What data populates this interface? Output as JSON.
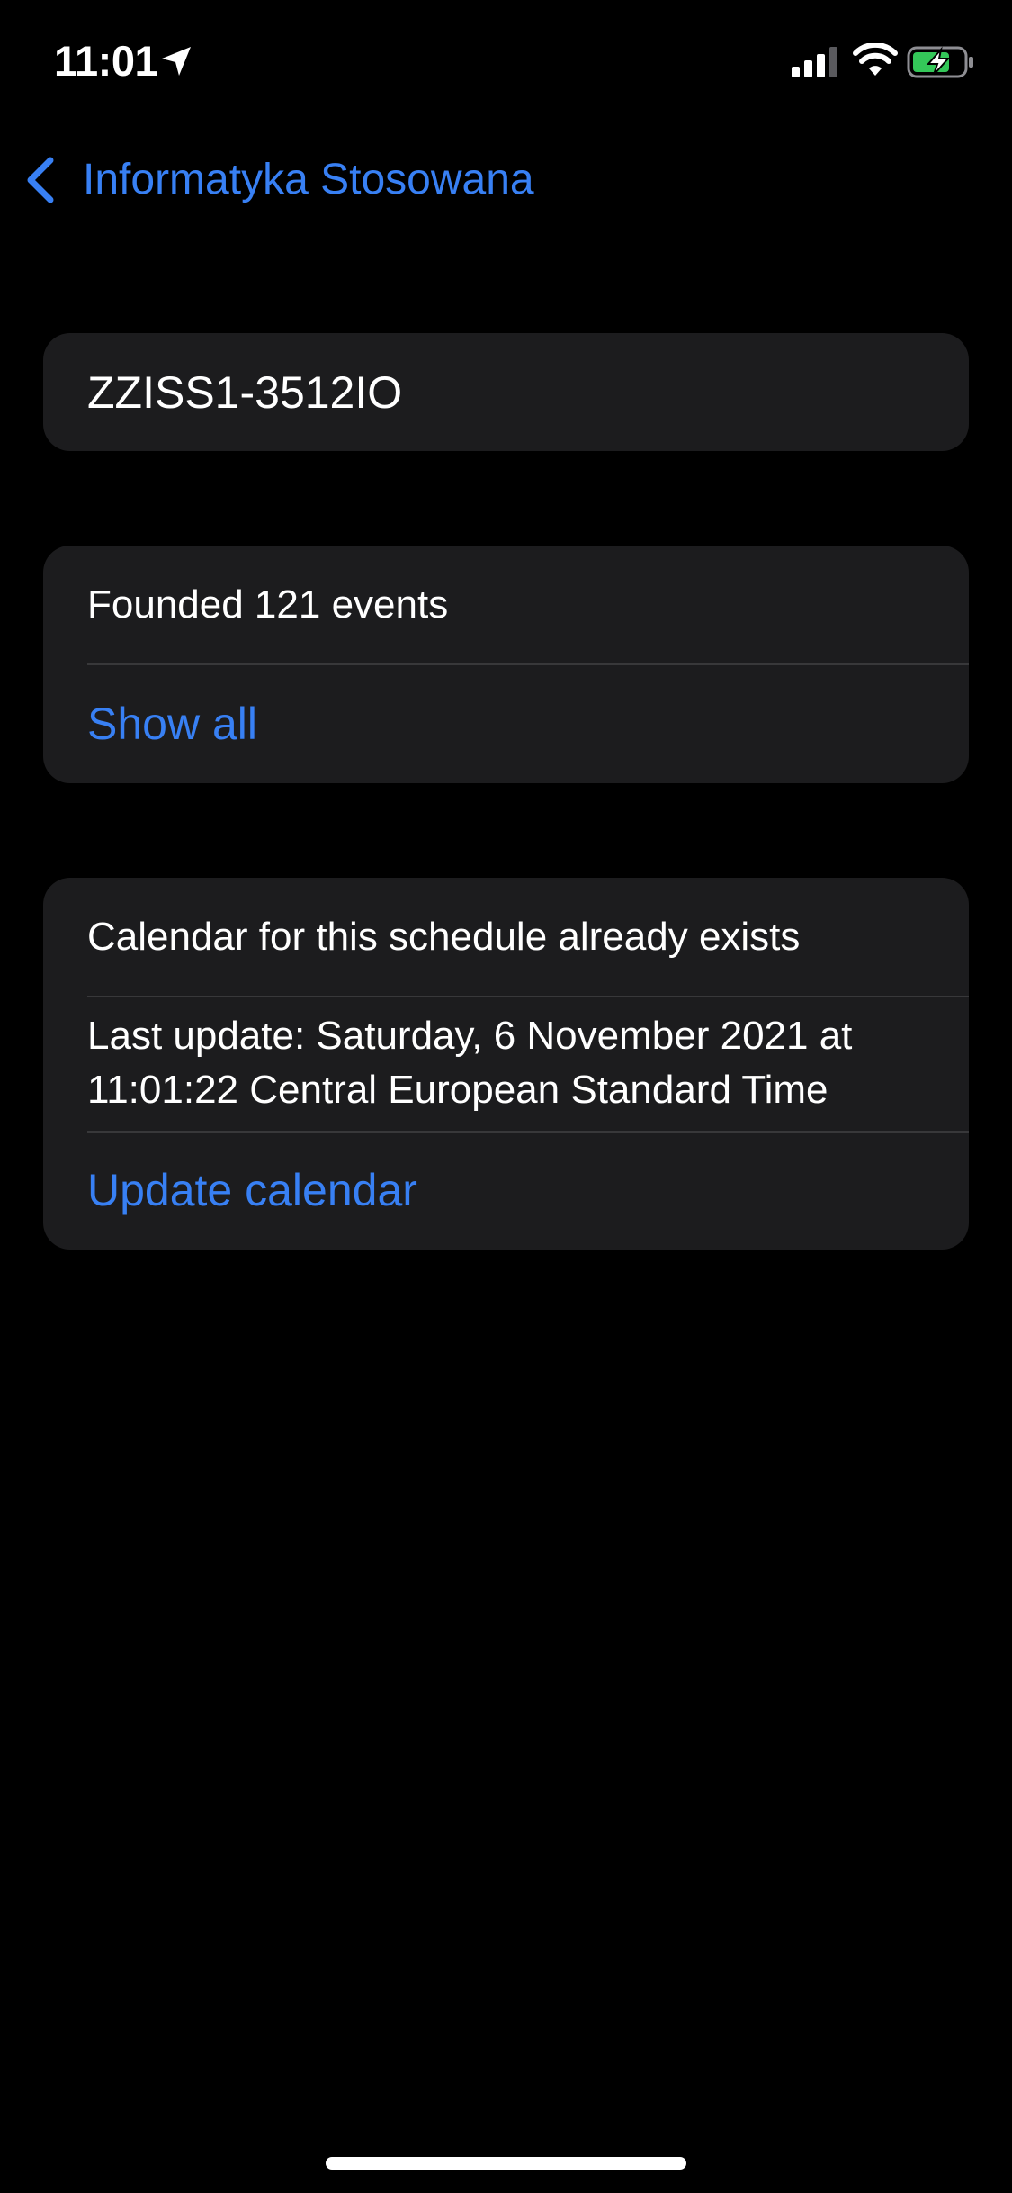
{
  "status_bar": {
    "time": "11:01",
    "icons": [
      "location-icon",
      "signal-icon",
      "wifi-icon",
      "battery-charging-icon"
    ]
  },
  "nav": {
    "back_label": "Informatyka Stosowana"
  },
  "schedule": {
    "name": "ZZISS1-3512IO"
  },
  "events": {
    "count_text": "Founded 121 events",
    "show_all_label": "Show all"
  },
  "calendar": {
    "status_text": "Calendar for this schedule already exists",
    "last_update_text": "Last update: Saturday, 6 November 2021 at 11:01:22 Central European Standard Time",
    "update_label": "Update calendar"
  },
  "colors": {
    "background": "#000000",
    "card": "#1c1c1e",
    "separator": "#38383a",
    "accent": "#3880f4",
    "battery_charge": "#34c759"
  }
}
